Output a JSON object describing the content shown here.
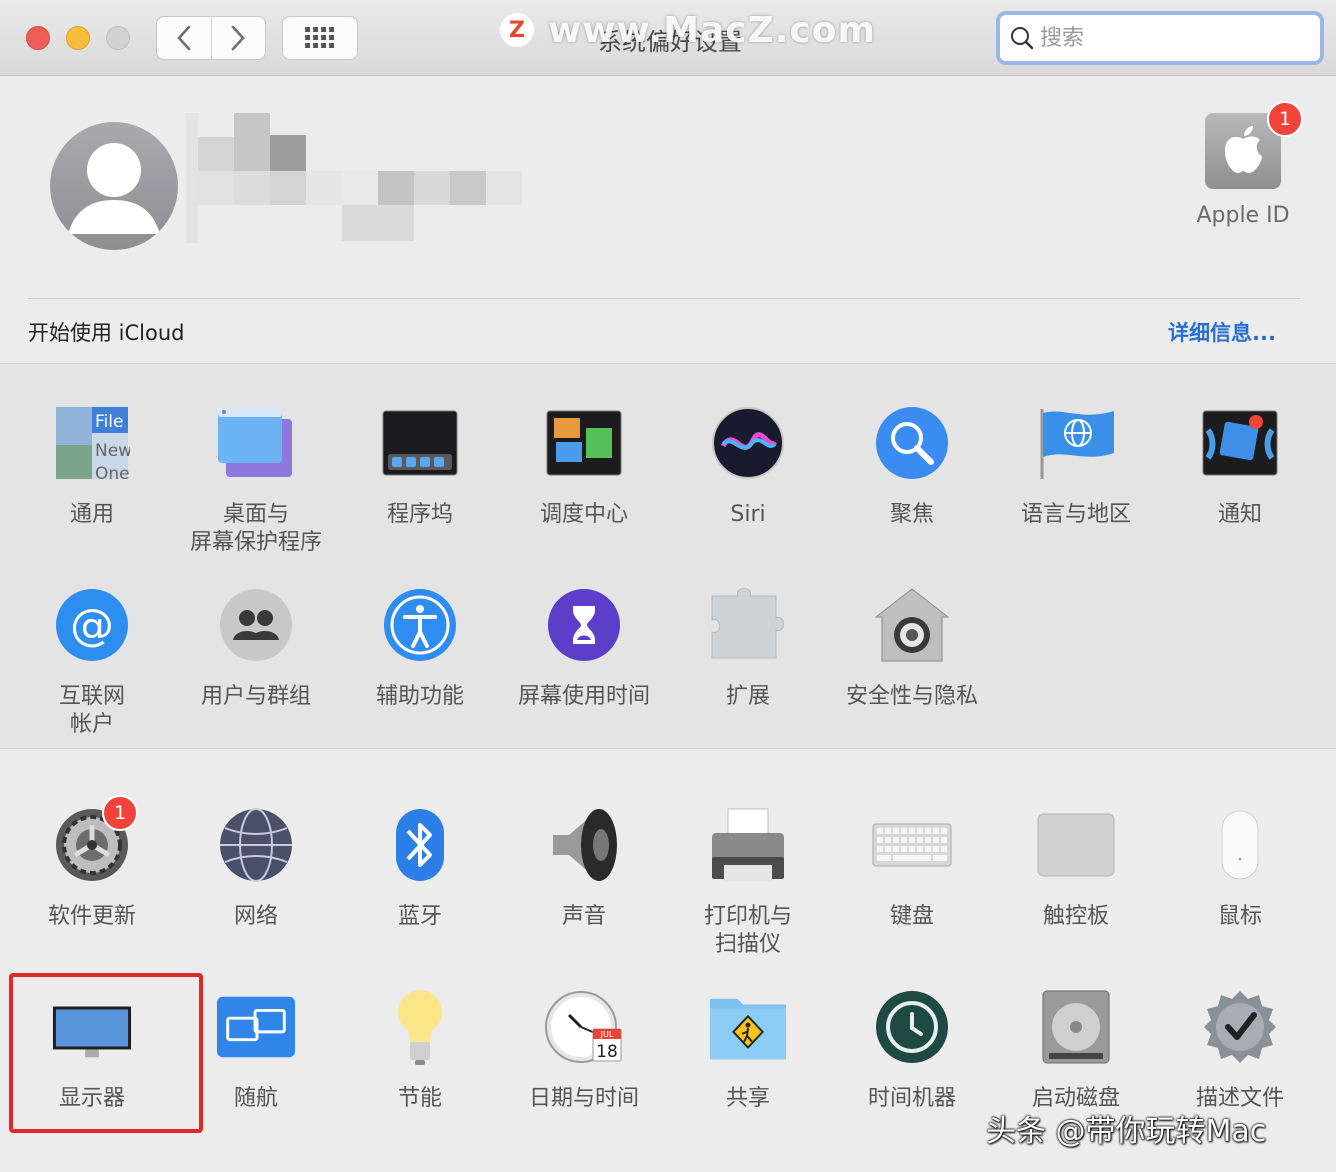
{
  "window": {
    "title": "系统偏好设置",
    "search_placeholder": "搜索"
  },
  "watermark": {
    "top_logo": "Z",
    "top_text": "www.MacZ.com",
    "bottom_text": "头条 @带你玩转Mac"
  },
  "account": {
    "apple_id_label": "Apple ID",
    "apple_id_badge": "1",
    "icloud_prompt": "开始使用 iCloud",
    "details_link": "详细信息..."
  },
  "row1": [
    {
      "id": "general",
      "label": "通用",
      "icon": "general-icon"
    },
    {
      "id": "desktop",
      "label": "桌面与\n屏幕保护程序",
      "icon": "desktop-screensaver-icon"
    },
    {
      "id": "dock",
      "label": "程序坞",
      "icon": "dock-icon"
    },
    {
      "id": "mission",
      "label": "调度中心",
      "icon": "mission-control-icon"
    },
    {
      "id": "siri",
      "label": "Siri",
      "icon": "siri-icon"
    },
    {
      "id": "spotlight",
      "label": "聚焦",
      "icon": "spotlight-icon"
    },
    {
      "id": "language",
      "label": "语言与地区",
      "icon": "language-region-icon"
    },
    {
      "id": "notifications",
      "label": "通知",
      "icon": "notifications-icon"
    }
  ],
  "row2": [
    {
      "id": "internet",
      "label": "互联网\n帐户",
      "icon": "internet-accounts-icon"
    },
    {
      "id": "users",
      "label": "用户与群组",
      "icon": "users-groups-icon"
    },
    {
      "id": "accessibility",
      "label": "辅助功能",
      "icon": "accessibility-icon"
    },
    {
      "id": "screentime",
      "label": "屏幕使用时间",
      "icon": "screen-time-icon"
    },
    {
      "id": "extensions",
      "label": "扩展",
      "icon": "extensions-icon"
    },
    {
      "id": "security",
      "label": "安全性与隐私",
      "icon": "security-privacy-icon"
    }
  ],
  "row3": [
    {
      "id": "update",
      "label": "软件更新",
      "icon": "software-update-icon",
      "badge": "1"
    },
    {
      "id": "network",
      "label": "网络",
      "icon": "network-icon"
    },
    {
      "id": "bluetooth",
      "label": "蓝牙",
      "icon": "bluetooth-icon"
    },
    {
      "id": "sound",
      "label": "声音",
      "icon": "sound-icon"
    },
    {
      "id": "printers",
      "label": "打印机与\n扫描仪",
      "icon": "printers-scanners-icon"
    },
    {
      "id": "keyboard",
      "label": "键盘",
      "icon": "keyboard-icon"
    },
    {
      "id": "trackpad",
      "label": "触控板",
      "icon": "trackpad-icon"
    },
    {
      "id": "mouse",
      "label": "鼠标",
      "icon": "mouse-icon"
    }
  ],
  "row4": [
    {
      "id": "displays",
      "label": "显示器",
      "icon": "displays-icon"
    },
    {
      "id": "sidecar",
      "label": "随航",
      "icon": "sidecar-icon"
    },
    {
      "id": "energy",
      "label": "节能",
      "icon": "energy-saver-icon"
    },
    {
      "id": "datetime",
      "label": "日期与时间",
      "icon": "date-time-icon",
      "cal_month": "JUL",
      "cal_day": "18"
    },
    {
      "id": "sharing",
      "label": "共享",
      "icon": "sharing-icon"
    },
    {
      "id": "timemachine",
      "label": "时间机器",
      "icon": "time-machine-icon"
    },
    {
      "id": "startup",
      "label": "启动磁盘",
      "icon": "startup-disk-icon"
    },
    {
      "id": "profiles",
      "label": "描述文件",
      "icon": "profiles-icon"
    }
  ],
  "general_icon_text": [
    "File",
    "New",
    "One"
  ],
  "colors": {
    "accent": "#2a6fd0",
    "badge": "#f0433a",
    "highlight": "#e02a2a"
  }
}
